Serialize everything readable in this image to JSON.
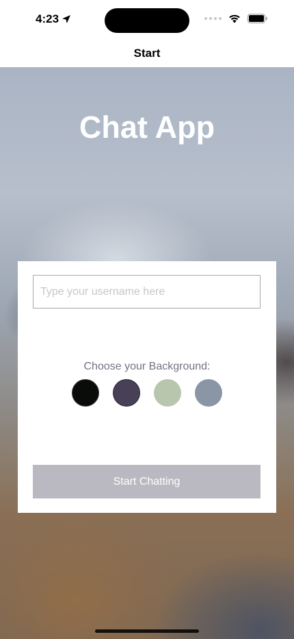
{
  "status_bar": {
    "time": "4:23"
  },
  "nav": {
    "title": "Start"
  },
  "app": {
    "title": "Chat App"
  },
  "form": {
    "username_placeholder": "Type your username here",
    "username_value": "",
    "background_label": "Choose your Background:",
    "background_colors": [
      "#090c08",
      "#474056",
      "#b9c6ae",
      "#8a95a5"
    ],
    "start_button_label": "Start Chatting"
  },
  "colors": {
    "button_bg": "#bab9c1",
    "label_text": "#757083"
  }
}
